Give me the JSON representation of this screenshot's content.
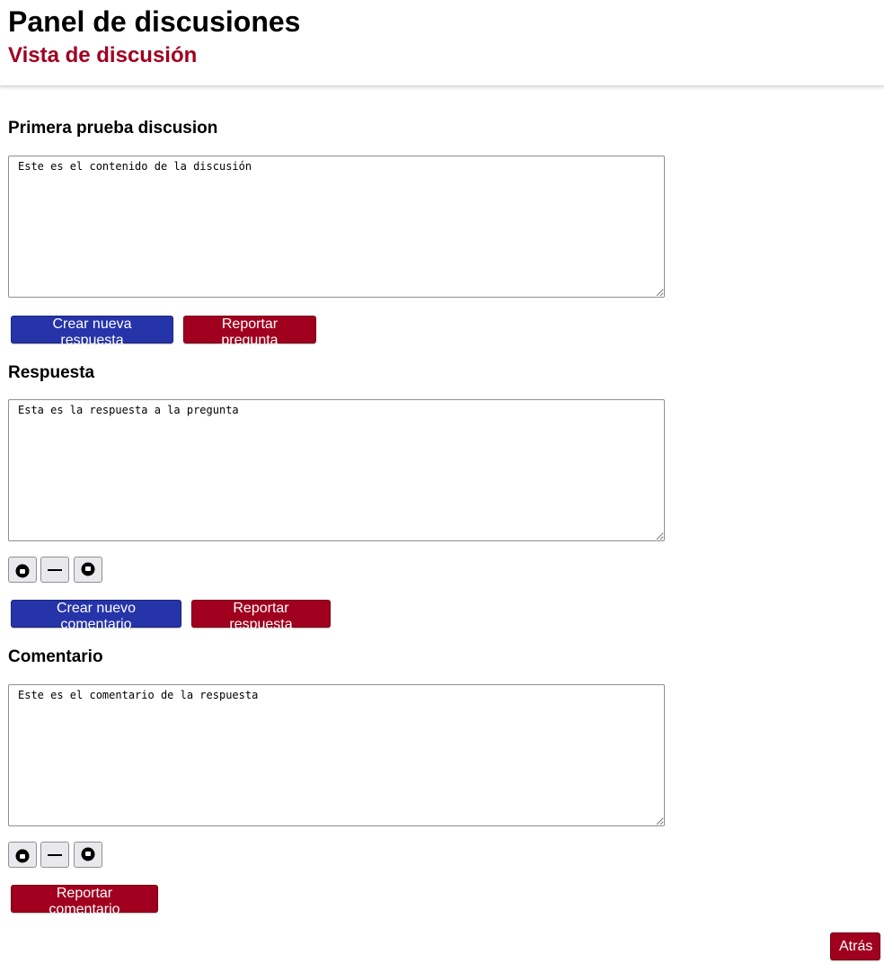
{
  "header": {
    "title": "Panel de discusiones",
    "subtitle": "Vista de discusión"
  },
  "question": {
    "title": "Primera prueba discusion",
    "content": "Este es el contenido de la discusión",
    "create_answer_label": "Crear nueva respuesta",
    "report_label": "Reportar pregunta"
  },
  "answer": {
    "title": "Respuesta",
    "content": "Esta es la respuesta a la pregunta",
    "create_comment_label": "Crear nuevo comentario",
    "report_label": "Reportar respuesta",
    "votes": [
      "thumbs-up-icon",
      "neutral-dash-icon",
      "thumbs-down-icon"
    ]
  },
  "comment": {
    "title": "Comentario",
    "content": "Este es el comentario de la respuesta",
    "report_label": "Reportar comentario",
    "votes": [
      "thumbs-up-icon",
      "neutral-dash-icon",
      "thumbs-down-icon"
    ]
  },
  "back_label": "Atrás",
  "colors": {
    "primary_blue": "#2534a8",
    "danger_red": "#a0001e",
    "vote_button_bg": "#e9e9ed"
  }
}
